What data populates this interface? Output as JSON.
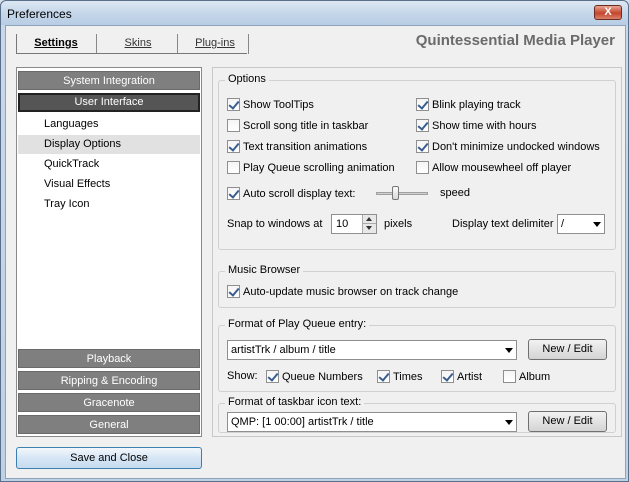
{
  "window": {
    "title": "Preferences",
    "close_glyph": "X"
  },
  "header": {
    "tabs": [
      "Settings",
      "Skins",
      "Plug-ins"
    ],
    "app_title": "Quintessential Media Player"
  },
  "nav": {
    "system_integration": "System Integration",
    "user_interface": "User Interface",
    "items": [
      "Languages",
      "Display Options",
      "QuickTrack",
      "Visual Effects",
      "Tray Icon"
    ],
    "selected_item": "Display Options",
    "playback": "Playback",
    "ripping": "Ripping & Encoding",
    "gracenote": "Gracenote",
    "general": "General"
  },
  "save_close": "Save and Close",
  "options": {
    "legend": "Options",
    "checks": [
      {
        "label": "Show ToolTips",
        "checked": true
      },
      {
        "label": "Blink playing track",
        "checked": true
      },
      {
        "label": "Scroll song title in taskbar",
        "checked": false
      },
      {
        "label": "Show time with hours",
        "checked": true
      },
      {
        "label": "Text transition animations",
        "checked": true
      },
      {
        "label": "Don't minimize undocked windows",
        "checked": true
      },
      {
        "label": "Play Queue scrolling animation",
        "checked": false
      },
      {
        "label": "Allow mousewheel off player",
        "checked": false
      }
    ],
    "auto_scroll": {
      "label": "Auto scroll display text:",
      "checked": true,
      "speed_label": "speed",
      "speed_level": 0.35
    },
    "snap": {
      "label": "Snap to windows at",
      "value": "10",
      "unit": "pixels"
    },
    "delimiter": {
      "label": "Display text delimiter",
      "value": "/"
    }
  },
  "music_browser": {
    "legend": "Music Browser",
    "auto_update": {
      "label": "Auto-update music browser on track change",
      "checked": true
    }
  },
  "play_queue": {
    "legend": "Format of Play Queue entry:",
    "format_value": "artistTrk / album / title",
    "new_edit": "New / Edit",
    "show_label": "Show:",
    "show_checks": [
      {
        "label": "Queue Numbers",
        "checked": true
      },
      {
        "label": "Times",
        "checked": true
      },
      {
        "label": "Artist",
        "checked": true
      },
      {
        "label": "Album",
        "checked": false
      }
    ]
  },
  "taskbar": {
    "legend": "Format of taskbar icon text:",
    "format_value": "QMP: [1 00:00] artistTrk / title",
    "new_edit": "New / Edit"
  }
}
